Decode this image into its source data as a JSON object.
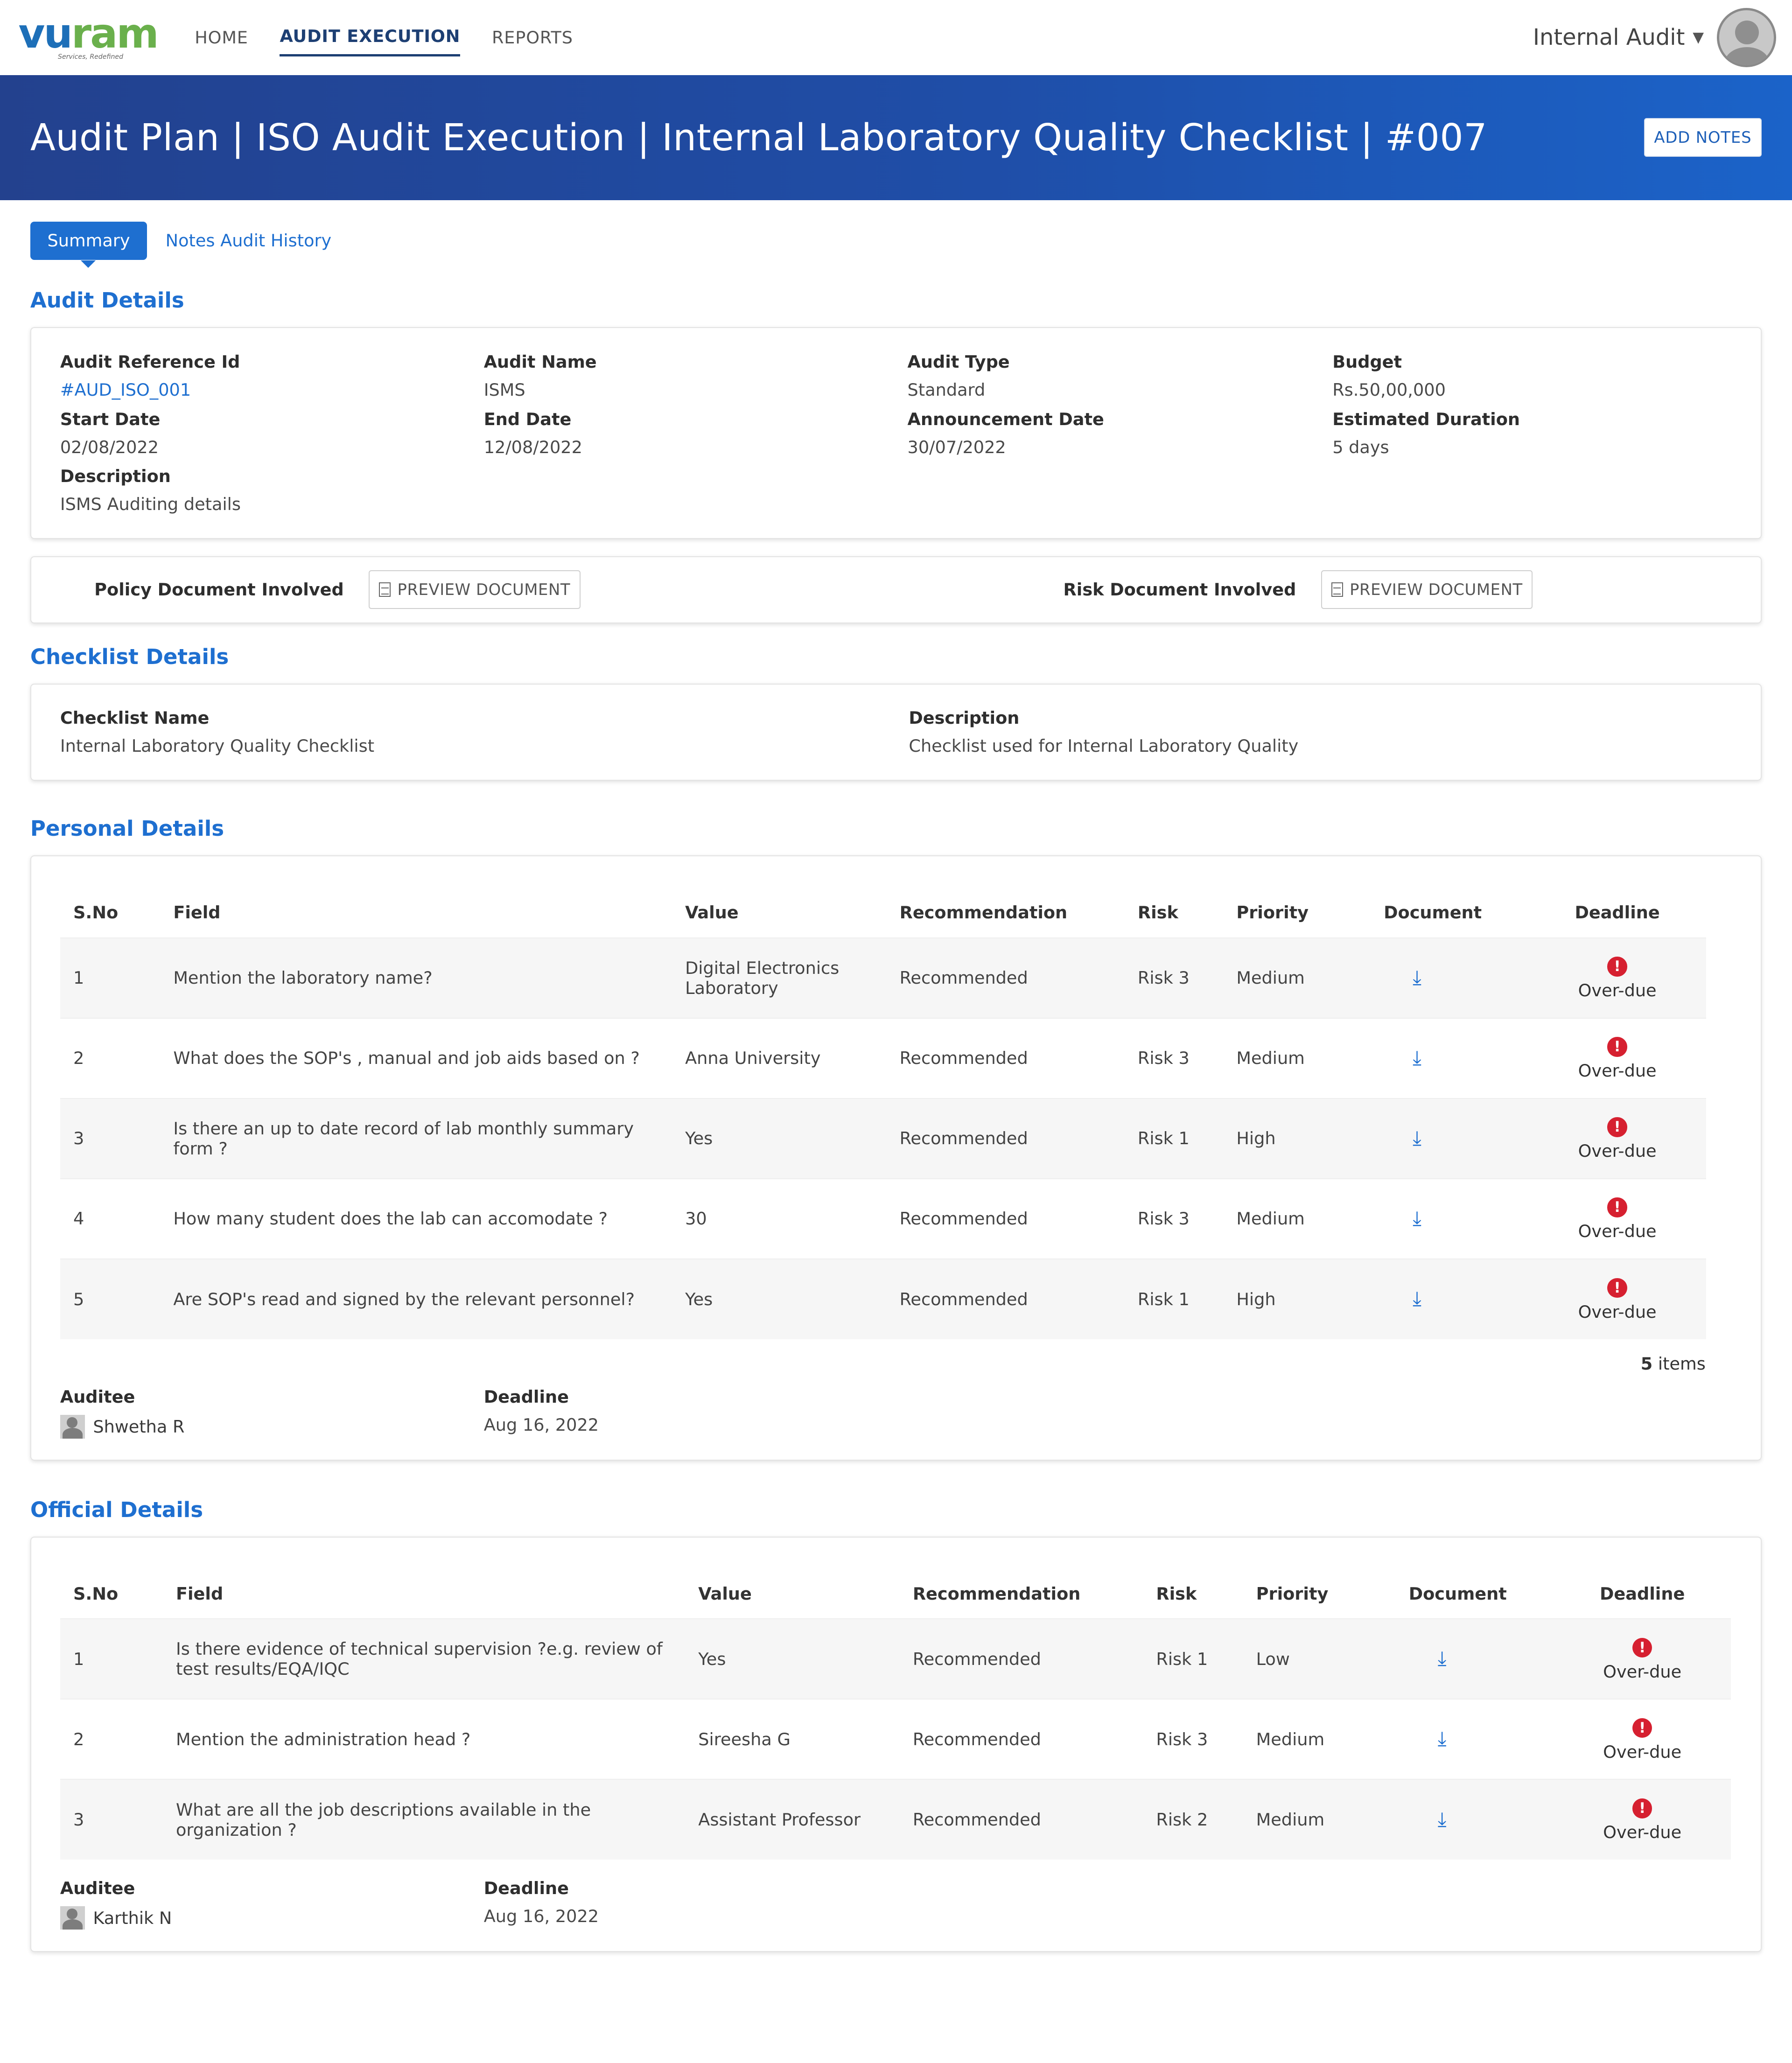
{
  "header": {
    "logo_text_a": "vu",
    "logo_text_b": "ram",
    "logo_tagline": "Services, Redefined",
    "nav": [
      "HOME",
      "AUDIT EXECUTION",
      "REPORTS"
    ],
    "role": "Internal Audit"
  },
  "banner": {
    "title": "Audit Plan | ISO Audit Execution | Internal Laboratory Quality Checklist | #007",
    "add_notes": "ADD NOTES"
  },
  "tabs": {
    "summary": "Summary",
    "notes_history": "Notes Audit History"
  },
  "audit_details": {
    "title": "Audit Details",
    "ref_label": "Audit Reference Id",
    "ref_value": "#AUD_ISO_001",
    "name_label": "Audit Name",
    "name_value": "ISMS",
    "type_label": "Audit Type",
    "type_value": "Standard",
    "budget_label": "Budget",
    "budget_value": "Rs.50,00,000",
    "start_label": "Start Date",
    "start_value": "02/08/2022",
    "end_label": "End Date",
    "end_value": "12/08/2022",
    "announce_label": "Announcement Date",
    "announce_value": "30/07/2022",
    "duration_label": "Estimated Duration",
    "duration_value": "5 days",
    "desc_label": "Description",
    "desc_value": "ISMS Auditing details"
  },
  "documents": {
    "policy_label": "Policy Document Involved",
    "risk_label": "Risk Document Involved",
    "preview": "PREVIEW DOCUMENT"
  },
  "checklist": {
    "title": "Checklist Details",
    "name_label": "Checklist Name",
    "name_value": "Internal Laboratory Quality  Checklist",
    "desc_label": "Description",
    "desc_value": "Checklist used for Internal Laboratory Quality"
  },
  "columns": [
    "S.No",
    "Field",
    "Value",
    "Recommendation",
    "Risk",
    "Priority",
    "Document",
    "Deadline"
  ],
  "personal": {
    "title": "Personal Details",
    "rows": [
      {
        "sno": "1",
        "field": "Mention the laboratory name?",
        "value": "Digital Electronics Laboratory",
        "rec": "Recommended",
        "risk": "Risk 3",
        "priority": "Medium",
        "deadline": "Over-due"
      },
      {
        "sno": "2",
        "field": "What does the SOP's , manual and job aids based on  ?",
        "value": "Anna University",
        "rec": "Recommended",
        "risk": "Risk 3",
        "priority": "Medium",
        "deadline": "Over-due"
      },
      {
        "sno": "3",
        "field": "Is there an up to date record of lab monthly summary form ?",
        "value": "Yes",
        "rec": "Recommended",
        "risk": "Risk 1",
        "priority": "High",
        "deadline": "Over-due"
      },
      {
        "sno": "4",
        "field": "How many student does the lab can accomodate ?",
        "value": "30",
        "rec": "Recommended",
        "risk": "Risk 3",
        "priority": "Medium",
        "deadline": "Over-due"
      },
      {
        "sno": "5",
        "field": "Are SOP's read and signed by the relevant personnel?",
        "value": "Yes",
        "rec": "Recommended",
        "risk": "Risk 1",
        "priority": "High",
        "deadline": "Over-due"
      }
    ],
    "count": "5",
    "count_suffix": "items",
    "auditee_label": "Auditee",
    "auditee": "Shwetha R",
    "deadline_label": "Deadline",
    "deadline": "Aug 16, 2022"
  },
  "official": {
    "title": "Official Details",
    "rows": [
      {
        "sno": "1",
        "field": "Is there evidence of technical supervision ?e.g. review of test results/EQA/IQC",
        "value": "Yes",
        "rec": "Recommended",
        "risk": "Risk 1",
        "priority": "Low",
        "deadline": "Over-due"
      },
      {
        "sno": "2",
        "field": "Mention the administration head  ?",
        "value": "Sireesha G",
        "rec": "Recommended",
        "risk": "Risk 3",
        "priority": "Medium",
        "deadline": "Over-due"
      },
      {
        "sno": "3",
        "field": "What are all the job descriptions available in the organization ?",
        "value": "Assistant Professor",
        "rec": "Recommended",
        "risk": "Risk 2",
        "priority": "Medium",
        "deadline": "Over-due"
      }
    ],
    "auditee_label": "Auditee",
    "auditee": "Karthik N",
    "deadline_label": "Deadline",
    "deadline": "Aug 16, 2022"
  }
}
